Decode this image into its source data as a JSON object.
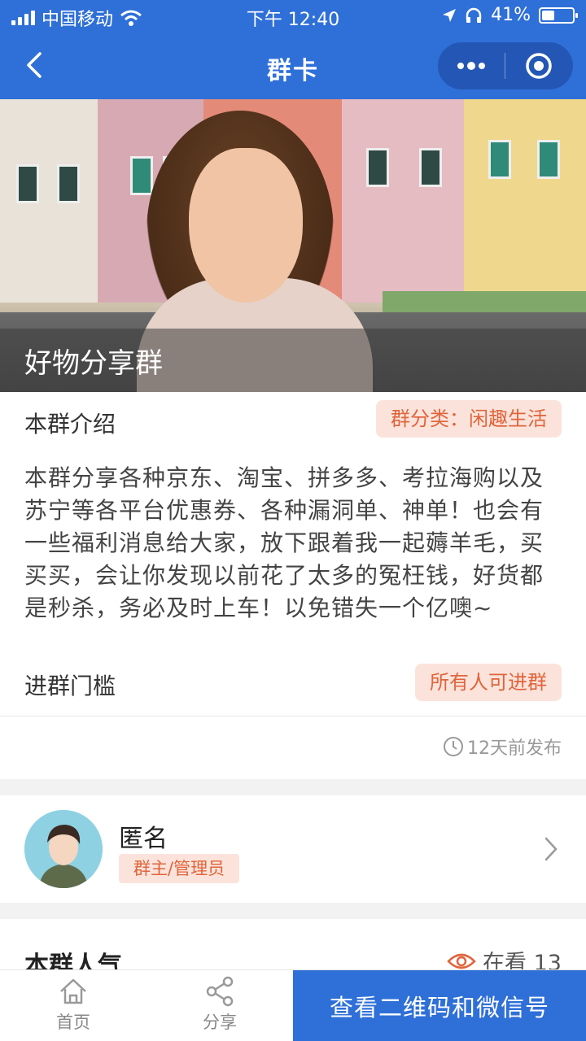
{
  "status": {
    "carrier": "中国移动",
    "time": "下午 12:40",
    "battery": "41%",
    "battery_level": 0.41
  },
  "nav": {
    "title": "群卡"
  },
  "hero": {
    "group_name": "好物分享群"
  },
  "intro": {
    "label": "本群介绍",
    "category_tag": "群分类：闲趣生活",
    "description": "本群分享各种京东、淘宝、拼多多、考拉海购以及苏宁等各平台优惠券、各种漏洞单、神单！也会有一些福利消息给大家，放下跟着我一起薅羊毛，买买买，会让你发现以前花了太多的冤枉钱，好货都是秒杀，务必及时上车！以免错失一个亿噢~",
    "threshold_label": "进群门槛",
    "threshold_tag": "所有人可进群",
    "posted": "12天前发布"
  },
  "owner": {
    "name": "匿名",
    "role": "群主/管理员"
  },
  "popularity": {
    "title": "本群人气",
    "watching": "在看 13"
  },
  "bottom": {
    "home": "首页",
    "share": "分享",
    "cta": "查看二维码和微信号"
  }
}
